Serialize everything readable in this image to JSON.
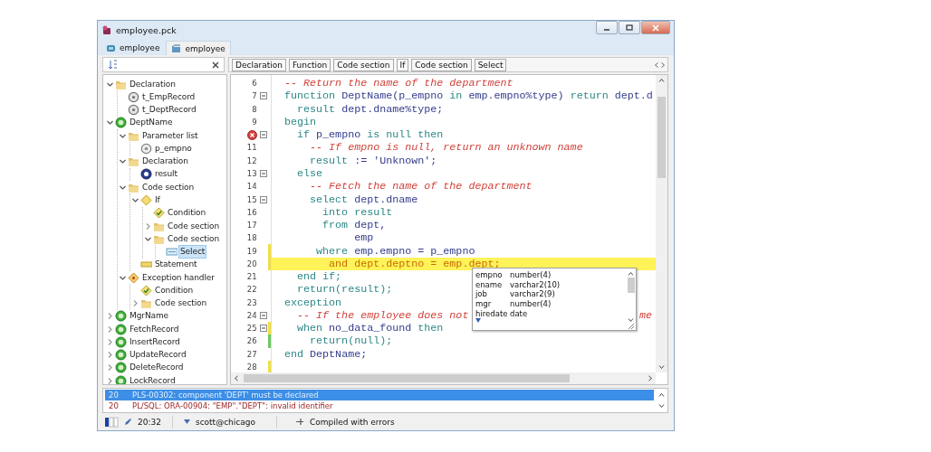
{
  "window": {
    "title": "employee.pck"
  },
  "tabs": [
    {
      "label": "employee",
      "selected": false
    },
    {
      "label": "employee",
      "selected": true
    }
  ],
  "tree": [
    {
      "label": "Declaration",
      "kind": "folder",
      "expanded": true,
      "selected": false,
      "children": [
        {
          "label": "t_EmpRecord",
          "kind": "type",
          "selected": false
        },
        {
          "label": "t_DeptRecord",
          "kind": "type",
          "selected": false
        }
      ]
    },
    {
      "label": "DeptName",
      "kind": "function",
      "expanded": true,
      "selected": false,
      "children": [
        {
          "label": "Parameter list",
          "kind": "folder",
          "expanded": true,
          "selected": false,
          "children": [
            {
              "label": "p_empno",
              "kind": "parameter",
              "selected": false
            }
          ]
        },
        {
          "label": "Declaration",
          "kind": "folder",
          "expanded": true,
          "selected": false,
          "children": [
            {
              "label": "result",
              "kind": "variable",
              "selected": false
            }
          ]
        },
        {
          "label": "Code section",
          "kind": "folder",
          "expanded": true,
          "selected": false,
          "children": [
            {
              "label": "If",
              "kind": "if",
              "expanded": true,
              "selected": false,
              "children": [
                {
                  "label": "Condition",
                  "kind": "condition",
                  "selected": false
                },
                {
                  "label": "Code section",
                  "kind": "folder",
                  "expanded": false,
                  "selected": false
                },
                {
                  "label": "Code section",
                  "kind": "folder",
                  "expanded": true,
                  "selected": false,
                  "children": [
                    {
                      "label": "Select",
                      "kind": "select",
                      "selected": true
                    }
                  ]
                }
              ]
            },
            {
              "label": "Statement",
              "kind": "statement",
              "selected": false
            }
          ]
        },
        {
          "label": "Exception handler",
          "kind": "exception",
          "expanded": true,
          "selected": false,
          "children": [
            {
              "label": "Condition",
              "kind": "condition",
              "selected": false
            },
            {
              "label": "Code section",
              "kind": "folder",
              "expanded": false,
              "selected": false
            }
          ]
        }
      ]
    },
    {
      "label": "MgrName",
      "kind": "function",
      "expanded": false,
      "selected": false
    },
    {
      "label": "FetchRecord",
      "kind": "function",
      "expanded": false,
      "selected": false
    },
    {
      "label": "InsertRecord",
      "kind": "function",
      "expanded": false,
      "selected": false
    },
    {
      "label": "UpdateRecord",
      "kind": "function",
      "expanded": false,
      "selected": false
    },
    {
      "label": "DeleteRecord",
      "kind": "function",
      "expanded": false,
      "selected": false
    },
    {
      "label": "LockRecord",
      "kind": "procedure",
      "expanded": false,
      "selected": false
    }
  ],
  "breadcrumb": [
    "Declaration",
    "Function",
    "Code section",
    "If",
    "Code section",
    "Select"
  ],
  "editor": {
    "lines": [
      {
        "number": "6",
        "fold": false,
        "highlighted": false,
        "segments": [
          {
            "kind": "comment",
            "text": "-- Return the name of the department"
          }
        ]
      },
      {
        "number": "7",
        "fold": true,
        "highlighted": false,
        "segments": [
          {
            "kind": "keyword",
            "text": "function "
          },
          {
            "kind": "name",
            "text": "DeptName(p_empno "
          },
          {
            "kind": "keyword",
            "text": "in "
          },
          {
            "kind": "name",
            "text": "emp.empno%type) "
          },
          {
            "kind": "keyword",
            "text": "return "
          },
          {
            "kind": "name",
            "text": "dept.d"
          }
        ]
      },
      {
        "number": "8",
        "fold": false,
        "highlighted": false,
        "segments": [
          {
            "kind": "keyword",
            "text": "  result "
          },
          {
            "kind": "name",
            "text": "dept.dname%type;"
          }
        ]
      },
      {
        "number": "9",
        "fold": false,
        "highlighted": false,
        "segments": [
          {
            "kind": "keyword",
            "text": "begin"
          }
        ]
      },
      {
        "error": true,
        "fold": true,
        "highlighted": false,
        "segments": [
          {
            "kind": "keyword",
            "text": "  if "
          },
          {
            "kind": "name",
            "text": "p_empno "
          },
          {
            "kind": "keyword",
            "text": "is null then"
          }
        ]
      },
      {
        "number": "11",
        "fold": false,
        "highlighted": false,
        "segments": [
          {
            "kind": "comment",
            "text": "    -- If empno is null, return an unknown name"
          }
        ]
      },
      {
        "number": "12",
        "fold": false,
        "highlighted": false,
        "segments": [
          {
            "kind": "keyword",
            "text": "    result "
          },
          {
            "kind": "name",
            "text": ":= 'Unknown';"
          }
        ]
      },
      {
        "number": "13",
        "fold": true,
        "highlighted": false,
        "segments": [
          {
            "kind": "keyword",
            "text": "  else"
          }
        ]
      },
      {
        "number": "14",
        "fold": false,
        "highlighted": false,
        "segments": [
          {
            "kind": "comment",
            "text": "    -- Fetch the name of the department"
          }
        ]
      },
      {
        "number": "15",
        "fold": true,
        "highlighted": false,
        "segments": [
          {
            "kind": "keyword",
            "text": "    select "
          },
          {
            "kind": "name",
            "text": "dept.dname"
          }
        ]
      },
      {
        "number": "16",
        "fold": false,
        "highlighted": false,
        "segments": [
          {
            "kind": "keyword",
            "text": "      into result"
          }
        ]
      },
      {
        "number": "17",
        "fold": false,
        "highlighted": false,
        "segments": [
          {
            "kind": "keyword",
            "text": "      from "
          },
          {
            "kind": "name",
            "text": "dept,"
          }
        ]
      },
      {
        "number": "18",
        "fold": false,
        "highlighted": false,
        "segments": [
          {
            "kind": "name",
            "text": "           emp"
          }
        ]
      },
      {
        "number": "19",
        "fold": false,
        "highlighted": false,
        "color": "#f0e040",
        "segments": [
          {
            "kind": "keyword",
            "text": "     where "
          },
          {
            "kind": "name",
            "text": "emp.empno = p_empno"
          }
        ]
      },
      {
        "number": "20",
        "fold": false,
        "highlighted": true,
        "color": "#f0e040",
        "segments": [
          {
            "kind": "error",
            "text": "       and dept.deptno = emp.dept;"
          }
        ]
      },
      {
        "number": "21",
        "fold": false,
        "highlighted": false,
        "segments": [
          {
            "kind": "keyword",
            "text": "  end if;"
          }
        ]
      },
      {
        "number": "22",
        "fold": false,
        "highlighted": false,
        "segments": [
          {
            "kind": "keyword",
            "text": "  return(result);"
          }
        ]
      },
      {
        "number": "23",
        "fold": false,
        "highlighted": false,
        "segments": [
          {
            "kind": "keyword",
            "text": "exception"
          }
        ]
      },
      {
        "number": "24",
        "fold": true,
        "highlighted": false,
        "segments": [
          {
            "kind": "comment",
            "text": "  -- If the employee does not"
          },
          {
            "kind": "comment-tail",
            "text": "me"
          }
        ]
      },
      {
        "number": "25",
        "fold": true,
        "highlighted": false,
        "color": "#f0e040",
        "segments": [
          {
            "kind": "keyword",
            "text": "  when "
          },
          {
            "kind": "name",
            "text": "no_data_found "
          },
          {
            "kind": "keyword",
            "text": "then"
          }
        ]
      },
      {
        "number": "26",
        "fold": false,
        "highlighted": false,
        "color": "#6cc860",
        "segments": [
          {
            "kind": "keyword",
            "text": "    return(null);"
          }
        ]
      },
      {
        "number": "27",
        "fold": false,
        "highlighted": false,
        "segments": [
          {
            "kind": "keyword",
            "text": "end "
          },
          {
            "kind": "name",
            "text": "DeptName;"
          }
        ]
      },
      {
        "number": "28",
        "fold": false,
        "highlighted": false,
        "color": "#f0e040"
      }
    ],
    "completion": [
      {
        "name": "empno",
        "type": "number(4)"
      },
      {
        "name": "ename",
        "type": "varchar2(10)"
      },
      {
        "name": "job",
        "type": "varchar2(9)"
      },
      {
        "name": "mgr",
        "type": "number(4)"
      },
      {
        "name": "hiredate",
        "type": "date"
      }
    ]
  },
  "messages": [
    {
      "line": "20",
      "text": "PLS-00302: component 'DEPT' must be declared",
      "selected": true
    },
    {
      "line": "20",
      "text": "PL/SQL: ORA-00904: \"EMP\".\"DEPT\": invalid identifier",
      "selected": false
    }
  ],
  "status_bar": {
    "position": "20:32",
    "connection": "scott@chicago",
    "message": "Compiled with errors"
  }
}
